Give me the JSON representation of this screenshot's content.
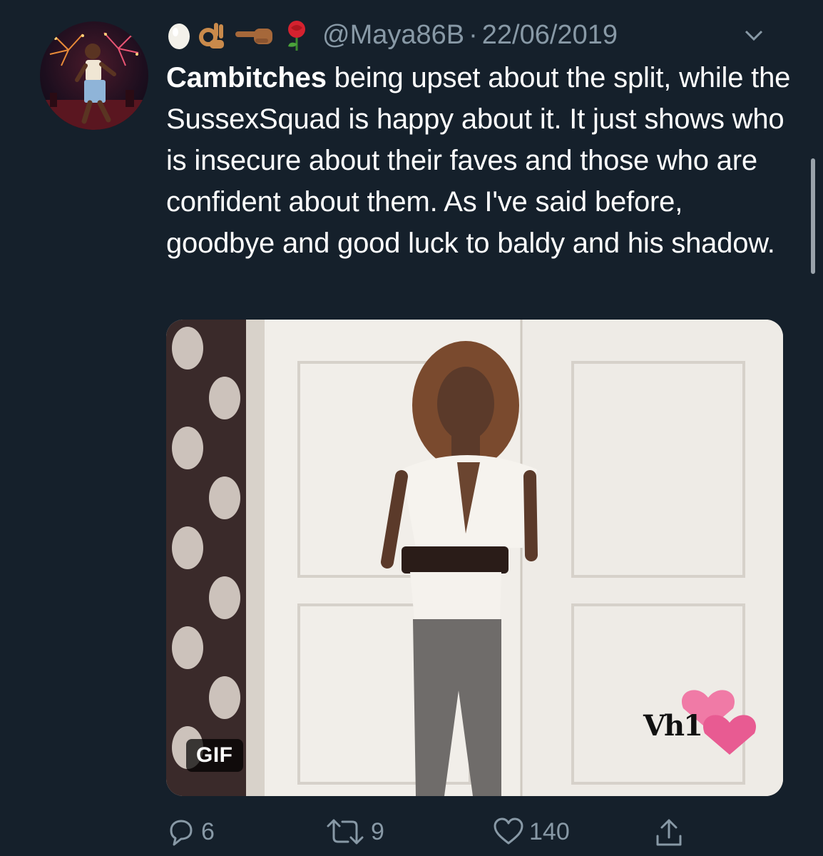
{
  "tweet": {
    "display_name_emojis": [
      "egg-emoji",
      "ok-hand-emoji",
      "pointing-left-emoji",
      "rose-emoji"
    ],
    "handle": "@Maya86B",
    "separator": "·",
    "date": "22/06/2019",
    "text_bold": "Cambitches",
    "text_rest": " being upset about the split, while the SussexSquad is happy about it. It just shows who is insecure about their faves and those who are confident about them. As I've said before, goodbye and good luck to baldy and his shadow.",
    "media": {
      "badge": "GIF",
      "watermark": "Vh1"
    },
    "actions": {
      "reply_count": "6",
      "retweet_count": "9",
      "like_count": "140"
    }
  },
  "colors": {
    "background": "#15202b",
    "text": "#ffffff",
    "secondary": "#8899a6"
  }
}
